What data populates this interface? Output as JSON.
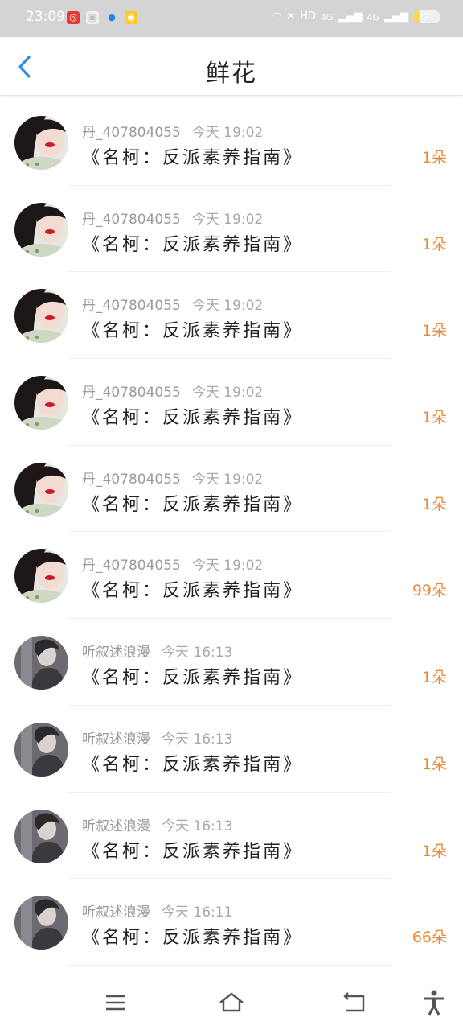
{
  "status": {
    "time": "23:09",
    "battery": "22",
    "net1": "4G",
    "net2": "4G"
  },
  "header": {
    "title": "鲜花"
  },
  "rows": [
    {
      "user": "丹_407804055",
      "time": "今天 19:02",
      "book": "《名柯：反派素养指南》",
      "count": "1朵",
      "avatar": "red"
    },
    {
      "user": "丹_407804055",
      "time": "今天 19:02",
      "book": "《名柯：反派素养指南》",
      "count": "1朵",
      "avatar": "red"
    },
    {
      "user": "丹_407804055",
      "time": "今天 19:02",
      "book": "《名柯：反派素养指南》",
      "count": "1朵",
      "avatar": "red"
    },
    {
      "user": "丹_407804055",
      "time": "今天 19:02",
      "book": "《名柯：反派素养指南》",
      "count": "1朵",
      "avatar": "red"
    },
    {
      "user": "丹_407804055",
      "time": "今天 19:02",
      "book": "《名柯：反派素养指南》",
      "count": "1朵",
      "avatar": "red"
    },
    {
      "user": "丹_407804055",
      "time": "今天 19:02",
      "book": "《名柯：反派素养指南》",
      "count": "99朵",
      "avatar": "red"
    },
    {
      "user": "听叙述浪漫",
      "time": "今天 16:13",
      "book": "《名柯：反派素养指南》",
      "count": "1朵",
      "avatar": "gray"
    },
    {
      "user": "听叙述浪漫",
      "time": "今天 16:13",
      "book": "《名柯：反派素养指南》",
      "count": "1朵",
      "avatar": "gray"
    },
    {
      "user": "听叙述浪漫",
      "time": "今天 16:13",
      "book": "《名柯：反派素养指南》",
      "count": "1朵",
      "avatar": "gray"
    },
    {
      "user": "听叙述浪漫",
      "time": "今天 16:11",
      "book": "《名柯：反派素养指南》",
      "count": "66朵",
      "avatar": "gray"
    }
  ],
  "colors": {
    "accent": "#2f8de4",
    "count": "#e88c3c"
  }
}
